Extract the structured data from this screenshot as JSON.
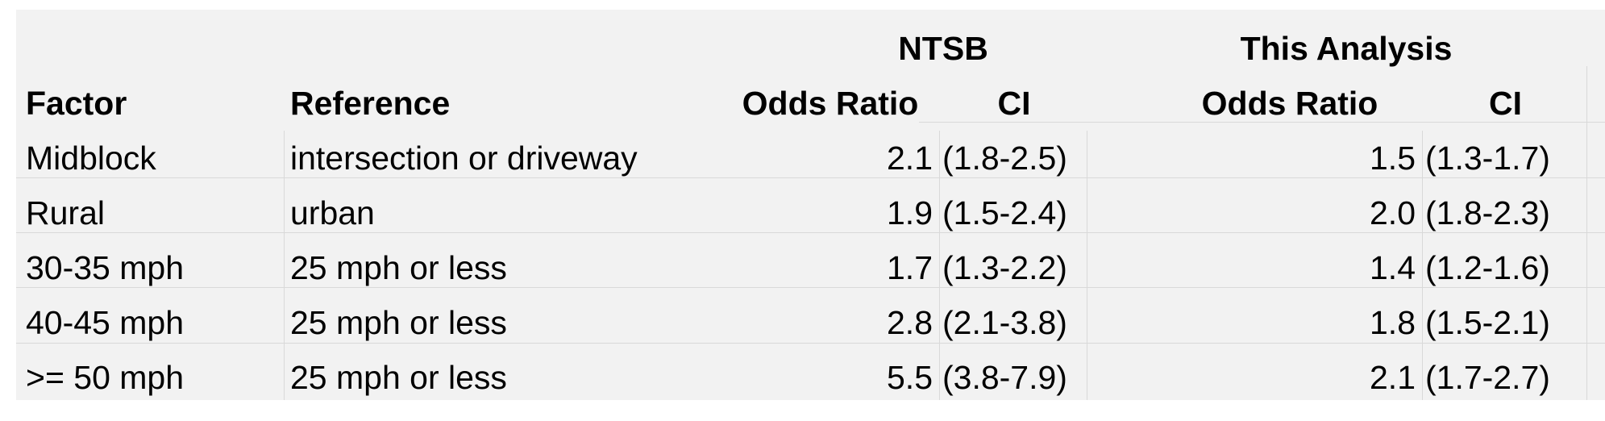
{
  "table": {
    "group_headers": {
      "ntsb": "NTSB",
      "this_analysis": "This Analysis"
    },
    "column_headers": {
      "factor": "Factor",
      "reference": "Reference",
      "ntsb_odds_ratio": "Odds Ratio",
      "ntsb_ci": "CI",
      "ta_odds_ratio": "Odds Ratio",
      "ta_ci": "CI"
    },
    "rows": [
      {
        "factor": "Midblock",
        "reference": "intersection or driveway",
        "ntsb_or": "2.1",
        "ntsb_ci": "(1.8-2.5)",
        "ta_or": "1.5",
        "ta_ci": "(1.3-1.7)"
      },
      {
        "factor": "Rural",
        "reference": "urban",
        "ntsb_or": "1.9",
        "ntsb_ci": "(1.5-2.4)",
        "ta_or": "2.0",
        "ta_ci": "(1.8-2.3)"
      },
      {
        "factor": "30-35 mph",
        "reference": "25 mph or less",
        "ntsb_or": "1.7",
        "ntsb_ci": "(1.3-2.2)",
        "ta_or": "1.4",
        "ta_ci": "(1.2-1.6)"
      },
      {
        "factor": "40-45 mph",
        "reference": "25 mph or less",
        "ntsb_or": "2.8",
        "ntsb_ci": "(2.1-3.8)",
        "ta_or": "1.8",
        "ta_ci": "(1.5-2.1)"
      },
      {
        "factor": ">= 50 mph",
        "reference": "25 mph or less",
        "ntsb_or": "5.5",
        "ntsb_ci": "(3.8-7.9)",
        "ta_or": "2.1",
        "ta_ci": "(1.7-2.7)"
      }
    ]
  }
}
